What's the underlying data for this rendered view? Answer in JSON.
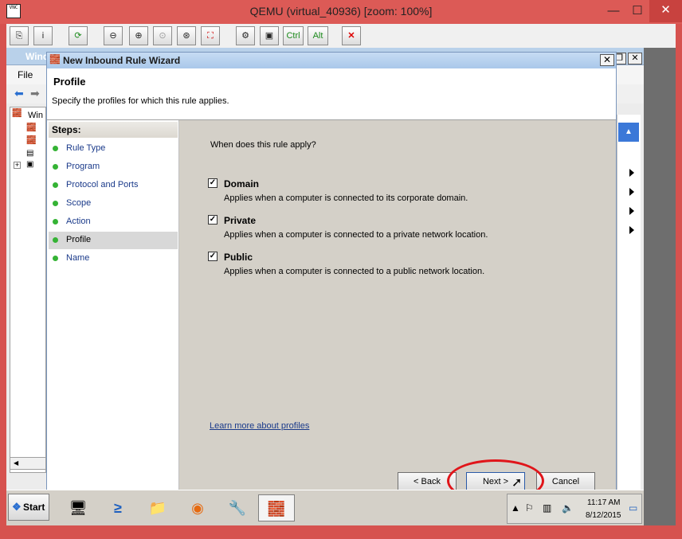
{
  "host": {
    "title": "QEMU (virtual_40936) [zoom: 100%]",
    "icon_text": "VNC",
    "minimize_label": "—",
    "maximize_label": "☐",
    "close_label": "✕",
    "toolbar": [
      {
        "name": "clipboard-icon",
        "glyph": "⎘"
      },
      {
        "name": "info-icon",
        "glyph": "i"
      },
      {
        "name": "refresh-icon",
        "glyph": "⟳"
      },
      {
        "name": "zoom-out-icon",
        "glyph": "⊖"
      },
      {
        "name": "zoom-in-icon",
        "glyph": "⊕"
      },
      {
        "name": "zoom-reset-icon",
        "glyph": "⊙"
      },
      {
        "name": "zoom-fit-icon",
        "glyph": "⊛"
      },
      {
        "name": "fullscreen-icon",
        "glyph": "⛶"
      },
      {
        "name": "options-icon",
        "glyph": "⚙"
      },
      {
        "name": "ctrl-alt-del-icon",
        "glyph": "▣"
      },
      {
        "name": "ctrl-key",
        "glyph": "Ctrl"
      },
      {
        "name": "alt-key",
        "glyph": "Alt"
      },
      {
        "name": "disconnect-icon",
        "glyph": "✕"
      }
    ]
  },
  "mmc": {
    "title": "Wind",
    "menu_file": "File",
    "tree_label": "Win"
  },
  "wizard": {
    "title": "New Inbound Rule Wizard",
    "close_label": "✕",
    "heading": "Profile",
    "subheading": "Specify the profiles for which this rule applies.",
    "steps_title": "Steps:",
    "steps": [
      {
        "label": "Rule Type"
      },
      {
        "label": "Program"
      },
      {
        "label": "Protocol and Ports"
      },
      {
        "label": "Scope"
      },
      {
        "label": "Action"
      },
      {
        "label": "Profile"
      },
      {
        "label": "Name"
      }
    ],
    "active_step": "Profile",
    "question": "When does this rule apply?",
    "options": [
      {
        "name": "Domain",
        "checked": true,
        "description": "Applies when a computer is connected to its corporate domain."
      },
      {
        "name": "Private",
        "checked": true,
        "description": "Applies when a computer is connected to a private network location."
      },
      {
        "name": "Public",
        "checked": true,
        "description": "Applies when a computer is connected to a public network location."
      }
    ],
    "check_mark": "✓",
    "learn_more": "Learn more about profiles",
    "back_label": "< Back",
    "next_label": "Next >",
    "cancel_label": "Cancel"
  },
  "taskbar": {
    "start_label": "Start",
    "apps": [
      {
        "name": "server-manager-icon",
        "glyph": "🖥"
      },
      {
        "name": "powershell-icon",
        "glyph": "≥"
      },
      {
        "name": "file-explorer-icon",
        "glyph": "📁"
      },
      {
        "name": "firefox-icon",
        "glyph": "◉"
      },
      {
        "name": "admin-tools-icon",
        "glyph": "🔧"
      },
      {
        "name": "firewall-icon",
        "glyph": "🧱"
      }
    ],
    "time": "11:17 AM",
    "date": "8/12/2015"
  },
  "colors": {
    "host_frame": "#dc5a56",
    "highlight_circle": "#e0151a",
    "step_dot": "#35b335"
  }
}
